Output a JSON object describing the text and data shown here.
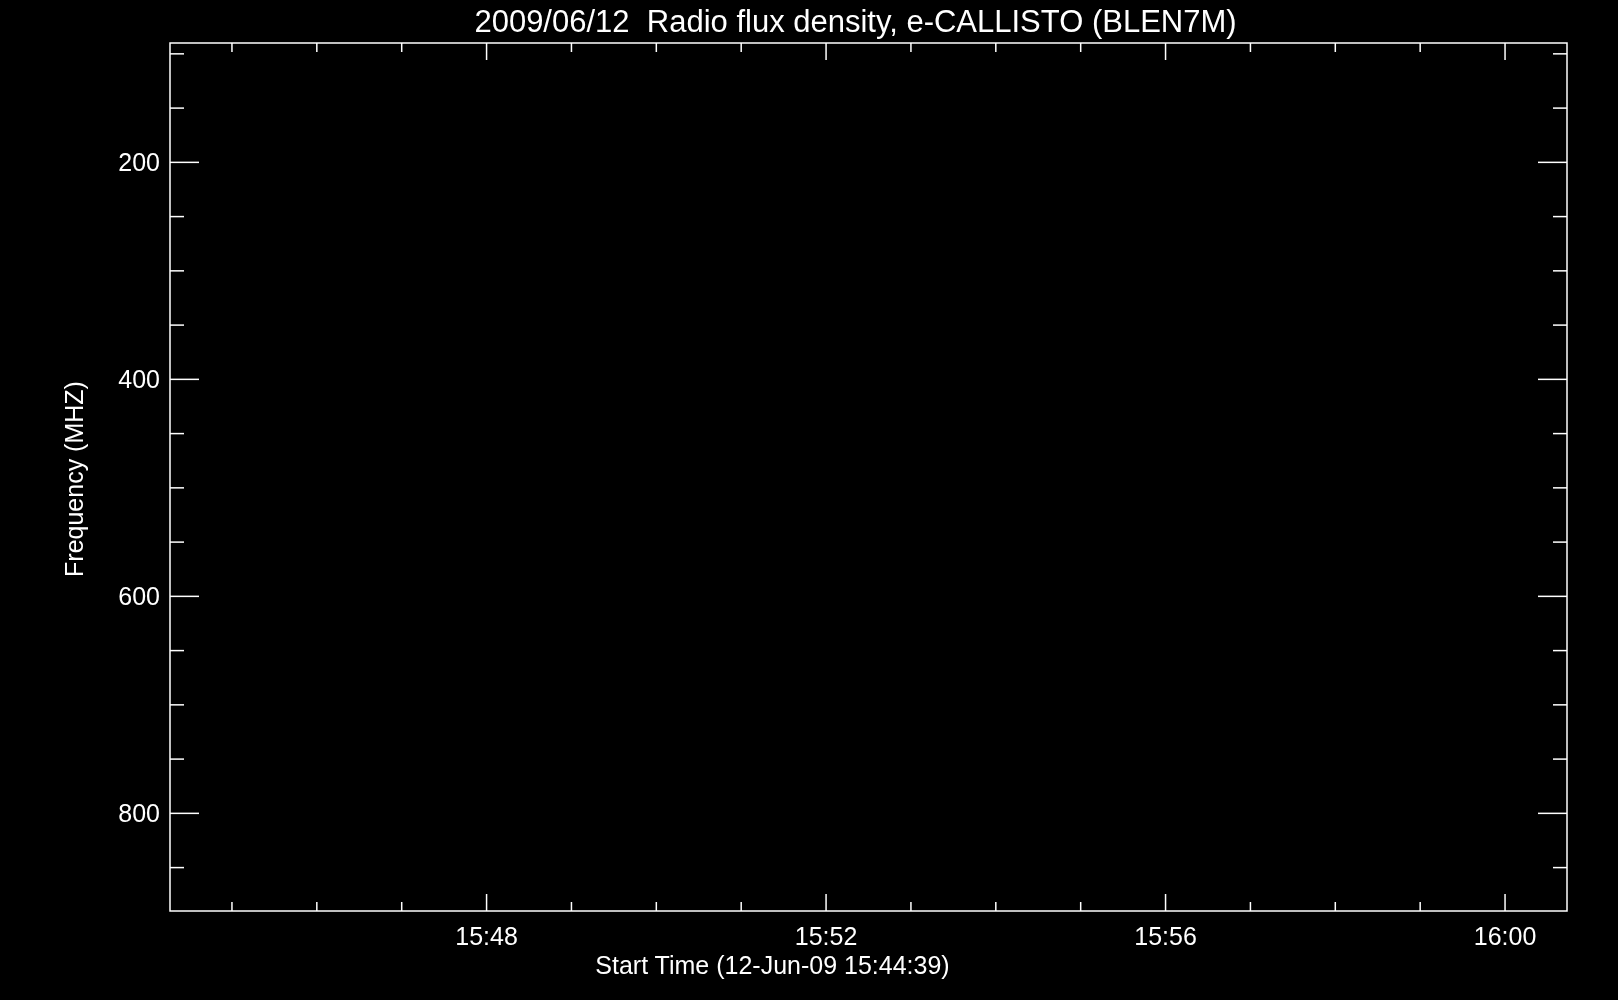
{
  "plot": {
    "chart_data": {
      "type": "line",
      "title": "2009/06/12  Radio flux density, e-CALLISTO (BLEN7M)",
      "xlabel": "Start Time (12-Jun-09 15:44:39)",
      "ylabel": "Frequency (MHZ)",
      "ylim": [
        890,
        90
      ],
      "categories": [
        "15:48",
        "15:52",
        "15:56",
        "16:00"
      ],
      "yticks": [
        200,
        400,
        600,
        800
      ]
    }
  }
}
